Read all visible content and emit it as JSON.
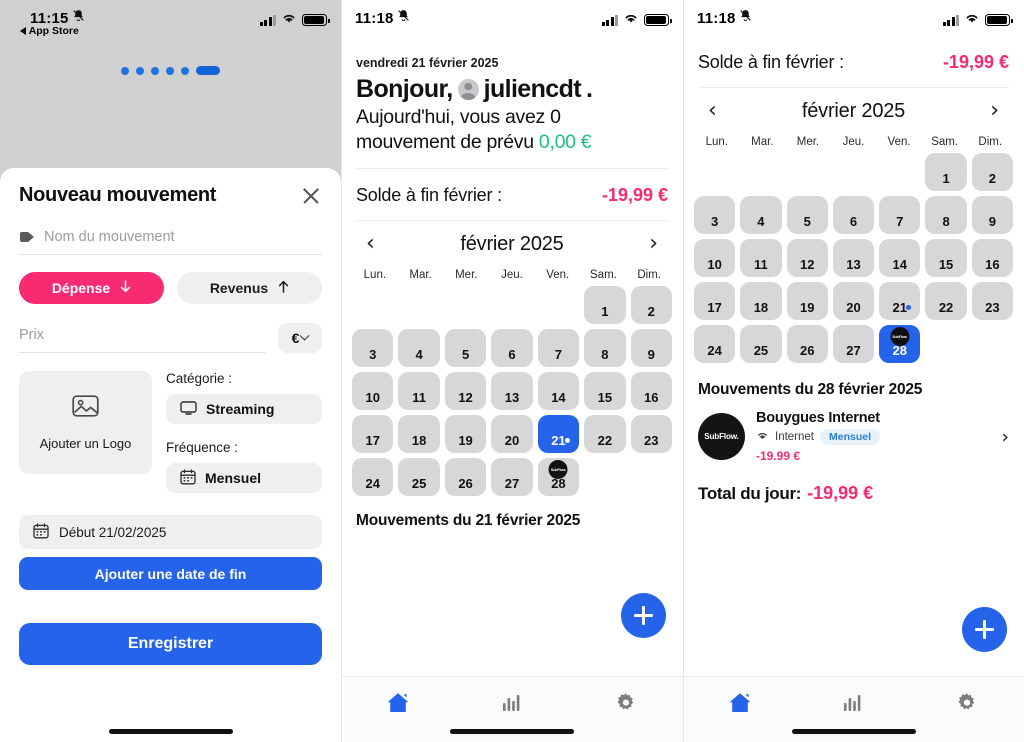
{
  "panel1": {
    "status": {
      "time": "11:15",
      "back_label": "App Store",
      "mute_icon": "bell-slash-icon"
    },
    "page_dots": {
      "count": 5,
      "active_pill": true
    },
    "sheet": {
      "title": "Nouveau mouvement",
      "close_icon": "close-icon",
      "name_placeholder": "Nom du mouvement",
      "name_icon": "tag-icon",
      "segment_expense": "Dépense",
      "segment_income": "Revenus",
      "price_placeholder": "Prix",
      "currency": "€",
      "logo_label": "Ajouter un Logo",
      "logo_icon": "image-icon",
      "category_label": "Catégorie :",
      "category_value": "Streaming",
      "category_icon": "monitor-icon",
      "frequency_label": "Fréquence :",
      "frequency_value": "Mensuel",
      "frequency_icon": "calendar-icon",
      "start_date": "Début 21/02/2025",
      "start_date_icon": "calendar-icon",
      "add_end_date": "Ajouter une date de fin",
      "save": "Enregistrer"
    }
  },
  "panel2": {
    "status": {
      "time": "11:18",
      "mute_icon": "bell-slash-icon"
    },
    "greeting": {
      "date": "vendredi 21 février 2025",
      "hello_prefix": "Bonjour,",
      "username": "juliencdt",
      "hello_suffix": ".",
      "line1": "Aujourd'hui, vous avez 0",
      "line2": "mouvement de prévu",
      "amount": "0,00 €"
    },
    "balance": {
      "label": "Solde à fin février :",
      "value": "-19,99 €"
    },
    "calendar": {
      "prev_icon": "chevron-left-icon",
      "next_icon": "chevron-right-icon",
      "title": "février 2025",
      "weekdays": [
        "Lun.",
        "Mar.",
        "Mer.",
        "Jeu.",
        "Ven.",
        "Sam.",
        "Dim."
      ],
      "leading_blanks": 5,
      "days": [
        1,
        2,
        3,
        4,
        5,
        6,
        7,
        8,
        9,
        10,
        11,
        12,
        13,
        14,
        15,
        16,
        17,
        18,
        19,
        20,
        21,
        22,
        23,
        24,
        25,
        26,
        27,
        28
      ],
      "selected_day": 21,
      "dot_days": [
        21
      ],
      "logo_days": [
        28
      ],
      "logo_text": "SubFlow."
    },
    "movements_title": "Mouvements du 21 février 2025",
    "fab_icon": "plus-icon",
    "tabs": [
      {
        "name": "home",
        "icon": "home-icon",
        "active": true
      },
      {
        "name": "stats",
        "icon": "bar-chart-icon",
        "active": false
      },
      {
        "name": "settings",
        "icon": "gear-icon",
        "active": false
      }
    ]
  },
  "panel3": {
    "status": {
      "time": "11:18",
      "mute_icon": "bell-slash-icon"
    },
    "balance": {
      "label": "Solde à fin février :",
      "value": "-19,99 €"
    },
    "calendar": {
      "prev_icon": "chevron-left-icon",
      "next_icon": "chevron-right-icon",
      "title": "février 2025",
      "weekdays": [
        "Lun.",
        "Mar.",
        "Mer.",
        "Jeu.",
        "Ven.",
        "Sam.",
        "Dim."
      ],
      "leading_blanks": 5,
      "days": [
        1,
        2,
        3,
        4,
        5,
        6,
        7,
        8,
        9,
        10,
        11,
        12,
        13,
        14,
        15,
        16,
        17,
        18,
        19,
        20,
        21,
        22,
        23,
        24,
        25,
        26,
        27,
        28
      ],
      "selected_day": 28,
      "dot_days": [
        21
      ],
      "logo_days": [
        28
      ],
      "logo_text": "SubFlow."
    },
    "movements_title": "Mouvements du 28 février 2025",
    "transaction": {
      "logo_text": "SubFlow.",
      "name": "Bouygues Internet",
      "category": "Internet",
      "category_icon": "wifi-icon",
      "badge": "Mensuel",
      "amount": "-19.99 €",
      "chevron_icon": "chevron-right-icon"
    },
    "total": {
      "label": "Total du jour:",
      "value": "-19,99 €"
    },
    "fab_icon": "plus-icon",
    "tabs": [
      {
        "name": "home",
        "icon": "home-icon",
        "active": true
      },
      {
        "name": "stats",
        "icon": "bar-chart-icon",
        "active": false
      },
      {
        "name": "settings",
        "icon": "gear-icon",
        "active": false
      }
    ]
  },
  "colors": {
    "accent_blue": "#2563eb",
    "accent_pink": "#f72a72",
    "green": "#18c37d",
    "cell_gray": "#d7d7d9",
    "chip_gray": "#efeff0"
  }
}
